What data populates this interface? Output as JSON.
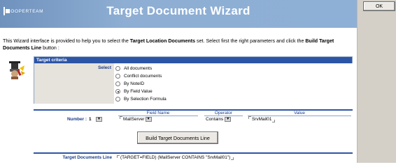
{
  "banner": {
    "logo_text": "COOPERTEAM",
    "title": "Target Document Wizard"
  },
  "intro": {
    "part1": "This Wizard interface is provided to help you to select the ",
    "bold1": "Target Location Documents",
    "part2": " set. Select first the right parameters and click the ",
    "bold2": "Build Target Documents Line",
    "part3": " button :"
  },
  "criteria": {
    "header": "Target criteria",
    "select_label": "Select",
    "options": [
      {
        "label": "All documents",
        "selected": false
      },
      {
        "label": "Conflict documents",
        "selected": false
      },
      {
        "label": "By NoteID",
        "selected": false
      },
      {
        "label": "By Field Value",
        "selected": true
      },
      {
        "label": "By Selection Formula",
        "selected": false
      }
    ]
  },
  "query": {
    "headers": {
      "field_name": "Field Name",
      "operator": "Operator",
      "value": "Value"
    },
    "number_label": "Number :",
    "number_value": "1",
    "field_name_value": "MailServer",
    "operator_value": "Contains",
    "value_value": "SrvMail01"
  },
  "build_button_label": "Build Target Documents Line",
  "target_line": {
    "label": "Target Documents Line",
    "value": "(TARGET=FIELD) (MailServer CONTAINS \"SrvMail01\")"
  },
  "side_panel": {
    "ok_label": "OK"
  },
  "icons": {
    "wizard": "wizard-hat-icon",
    "dropdown": "dropdown-arrow-icon"
  },
  "colors": {
    "banner": "#8eaed3",
    "section_header": "#2d55a5",
    "label_text": "#1a3d86"
  }
}
